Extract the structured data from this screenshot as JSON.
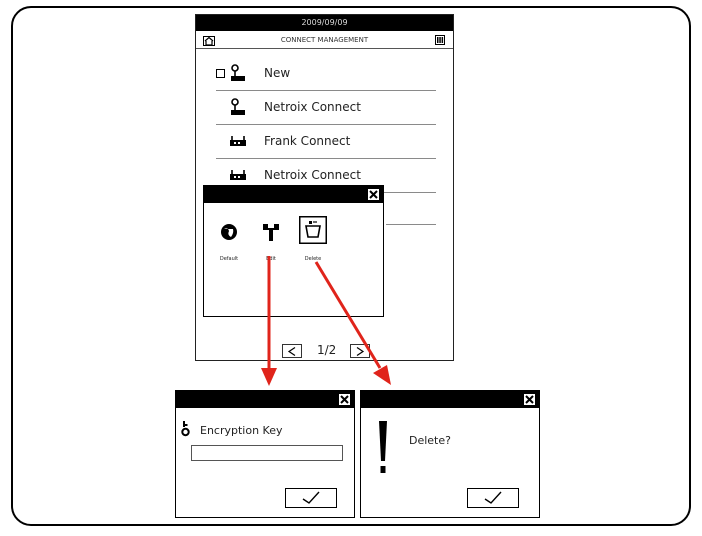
{
  "device": {
    "date": "2009/09/09",
    "title": "CONNECT MANAGEMENT",
    "connections": [
      {
        "label": "New",
        "icon": "new-connection-icon",
        "has_checkbox": true
      },
      {
        "label": "Netroix Connect",
        "icon": "network-antenna-icon",
        "has_checkbox": false
      },
      {
        "label": "Frank Connect",
        "icon": "router-icon",
        "has_checkbox": false
      },
      {
        "label": "Netroix Connect",
        "icon": "router-icon",
        "has_checkbox": false
      }
    ],
    "pager": {
      "text": "1/2"
    }
  },
  "context_menu": {
    "items": [
      {
        "label": "Default",
        "icon": "default-globe-icon"
      },
      {
        "label": "Edit",
        "icon": "wrench-edit-icon"
      },
      {
        "label": "Delete",
        "icon": "trash-delete-icon"
      }
    ]
  },
  "edit_dialog": {
    "label": "Encryption Key",
    "input_value": "",
    "icon": "key-icon",
    "confirm_icon": "checkmark-icon"
  },
  "delete_dialog": {
    "message": "Delete?",
    "icon": "exclamation-icon",
    "confirm_icon": "checkmark-icon"
  },
  "colors": {
    "arrow": "#e0241b",
    "bar": "#000000",
    "border": "#000000"
  }
}
